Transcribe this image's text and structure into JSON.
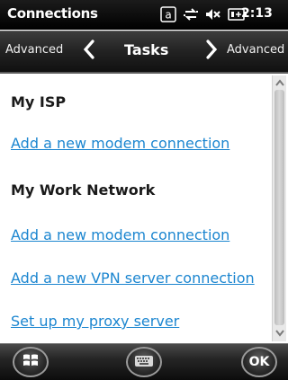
{
  "status_bar": {
    "title": "Connections",
    "time": "2:13",
    "icons": [
      "keyboard-a-icon",
      "network-connectivity-icon",
      "volume-muted-icon",
      "battery-icon"
    ]
  },
  "tab_bar": {
    "left_label": "Advanced",
    "center_label": "Tasks",
    "right_label": "Advanced"
  },
  "content": {
    "section_1": {
      "heading": "My ISP",
      "links": [
        "Add a new modem connection"
      ]
    },
    "section_2": {
      "heading": "My Work Network",
      "links": [
        "Add a new modem connection",
        "Add a new VPN server connection",
        "Set up my proxy server"
      ]
    }
  },
  "bottom_bar": {
    "ok_label": "OK",
    "buttons": [
      "windows-start-icon",
      "keyboard-icon",
      "ok-button"
    ]
  },
  "colors": {
    "link": "#1c86d0",
    "heading": "#1a1a1a",
    "bar_dark": "#101010"
  }
}
